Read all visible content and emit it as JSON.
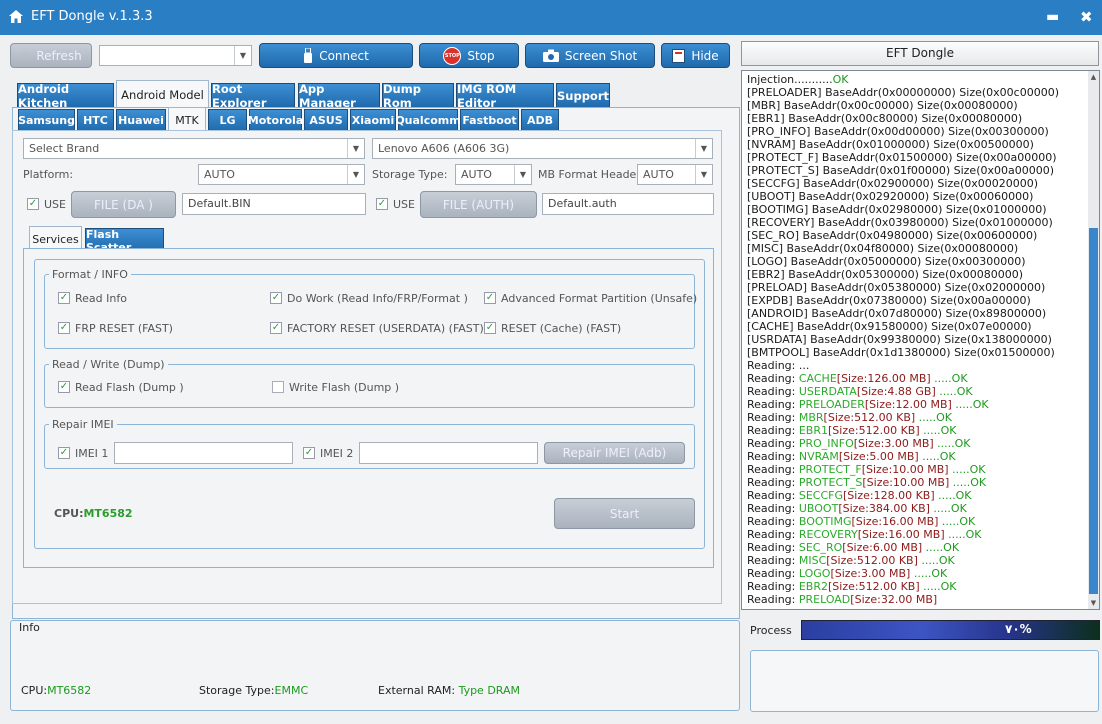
{
  "titlebar": {
    "title": "EFT Dongle  v.1.3.3",
    "min": "▬",
    "close": "✖"
  },
  "toolbar": {
    "refresh": "Refresh",
    "connect": "Connect",
    "stop": "Stop",
    "stop_badge": "STOP",
    "screenshot": "Screen Shot",
    "hide": "Hide",
    "port_value": ""
  },
  "tabs_main": [
    "Android Kitchen",
    "Android Model",
    "Root Explorer",
    "App Manager",
    "Dump Rom",
    "IMG ROM Editor",
    "Support"
  ],
  "tabs_brand": [
    "Samsung",
    "HTC",
    "Huawei",
    "MTK",
    "LG",
    "Motorola",
    "ASUS",
    "Xiaomi",
    "Qualcomm",
    "Fastboot",
    "ADB"
  ],
  "mtk": {
    "select_brand": "Select Brand",
    "model": "Lenovo A606 (A606 3G)",
    "platform_label": "Platform:",
    "platform": "AUTO",
    "storage_label": "Storage Type:",
    "storage": "AUTO",
    "mb_label": "MB Format Header",
    "mb": "AUTO",
    "use": "USE",
    "file_da": "FILE (DA )",
    "da_value": "Default.BIN",
    "file_auth": "FILE (AUTH)",
    "auth_value": "Default.auth"
  },
  "subtabs": [
    "Services",
    "Flash Scatter"
  ],
  "services": {
    "format_title": "Format / INFO",
    "read_info": "Read Info",
    "do_work": "Do Work (Read Info/FRP/Format )",
    "adv_format": "Advanced Format Partition (Unsafe)",
    "frp_reset": "FRP RESET (FAST)",
    "factory_reset": "FACTORY RESET (USERDATA) (FAST)",
    "reset_cache": "RESET (Cache) (FAST)",
    "rw_title": "Read / Write (Dump)",
    "read_flash": "Read Flash (Dump )",
    "write_flash": "Write Flash (Dump )",
    "imei_title": "Repair IMEI",
    "imei1": "IMEI 1",
    "imei2": "IMEI 2",
    "repair_btn": "Repair IMEI (Adb)",
    "cpu_label": "CPU:",
    "cpu": "MT6582",
    "start": "Start"
  },
  "info": {
    "title": "Info",
    "cpu_label": "CPU:",
    "cpu": "MT6582",
    "storage_label": "Storage Type:",
    "storage": "EMMC",
    "ram_label": "External RAM: ",
    "ram": "Type DRAM"
  },
  "side": {
    "title": "EFT Dongle",
    "process_label": "Process",
    "progress_text": "۷۰%",
    "progress_value": 0.7
  },
  "log": {
    "injection": "Injection...........",
    "ok": "OK",
    "base_lines": [
      "[PRELOADER] BaseAddr(0x00000000) Size(0x00c00000)",
      "[MBR] BaseAddr(0x00c00000) Size(0x00080000)",
      "[EBR1] BaseAddr(0x00c80000) Size(0x00080000)",
      "[PRO_INFO] BaseAddr(0x00d00000) Size(0x00300000)",
      "[NVRAM] BaseAddr(0x01000000) Size(0x00500000)",
      "[PROTECT_F] BaseAddr(0x01500000) Size(0x00a00000)",
      "[PROTECT_S] BaseAddr(0x01f00000) Size(0x00a00000)",
      "[SECCFG] BaseAddr(0x02900000) Size(0x00020000)",
      "[UBOOT] BaseAddr(0x02920000) Size(0x00060000)",
      "[BOOTIMG] BaseAddr(0x02980000) Size(0x01000000)",
      "[RECOVERY] BaseAddr(0x03980000) Size(0x01000000)",
      "[SEC_RO] BaseAddr(0x04980000) Size(0x00600000)",
      "[MISC] BaseAddr(0x04f80000) Size(0x00080000)",
      "[LOGO] BaseAddr(0x05000000) Size(0x00300000)",
      "[EBR2] BaseAddr(0x05300000) Size(0x00080000)",
      "[PRELOAD] BaseAddr(0x05380000) Size(0x02000000)",
      "[EXPDB] BaseAddr(0x07380000) Size(0x00a00000)",
      "[ANDROID] BaseAddr(0x07d80000) Size(0x89800000)",
      "[CACHE] BaseAddr(0x91580000) Size(0x07e00000)",
      "[USRDATA] BaseAddr(0x99380000) Size(0x138000000)",
      "[BMTPOOL] BaseAddr(0x1d1380000) Size(0x01500000)"
    ],
    "reading_plain": "Reading: ...",
    "reading_label": "Reading: ",
    "ok_suffix": " .....OK",
    "reads": [
      {
        "part": "CACHE",
        "size": "[Size:126.00 MB]"
      },
      {
        "part": "USERDATA",
        "size": "[Size:4.88 GB]"
      },
      {
        "part": "PRELOADER",
        "size": "[Size:12.00 MB]"
      },
      {
        "part": "MBR",
        "size": "[Size:512.00 KB]"
      },
      {
        "part": "EBR1",
        "size": "[Size:512.00 KB]"
      },
      {
        "part": "PRO_INFO",
        "size": "[Size:3.00 MB]"
      },
      {
        "part": "NVRAM",
        "size": "[Size:5.00 MB]"
      },
      {
        "part": "PROTECT_F",
        "size": "[Size:10.00 MB]"
      },
      {
        "part": "PROTECT_S",
        "size": "[Size:10.00 MB]"
      },
      {
        "part": "SECCFG",
        "size": "[Size:128.00 KB]"
      },
      {
        "part": "UBOOT",
        "size": "[Size:384.00 KB]"
      },
      {
        "part": "BOOTIMG",
        "size": "[Size:16.00 MB]"
      },
      {
        "part": "RECOVERY",
        "size": "[Size:16.00 MB]"
      },
      {
        "part": "SEC_RO",
        "size": "[Size:6.00 MB]"
      },
      {
        "part": "MISC",
        "size": "[Size:512.00 KB]"
      },
      {
        "part": "LOGO",
        "size": "[Size:3.00 MB]"
      },
      {
        "part": "EBR2",
        "size": "[Size:512.00 KB]"
      }
    ],
    "last_part": "PRELOAD",
    "last_size": "[Size:32.00 MB]"
  }
}
